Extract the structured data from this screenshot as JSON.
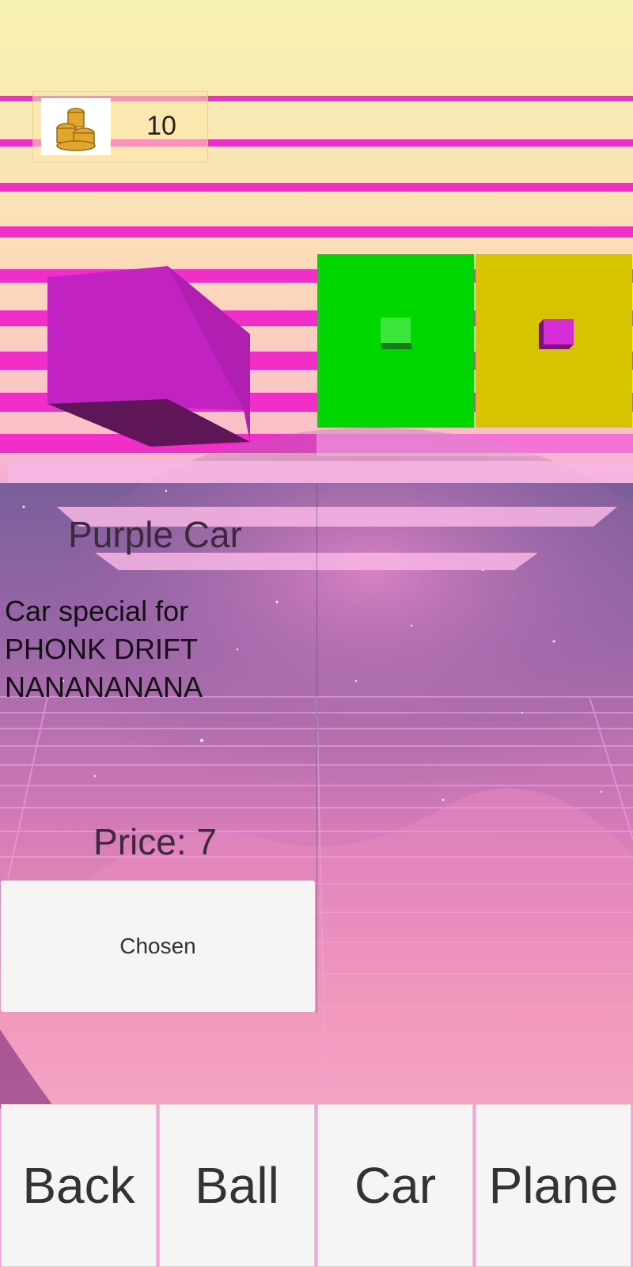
{
  "hud": {
    "coin_icon": "coin-stack-icon",
    "coins": "10"
  },
  "shop": {
    "items": [
      {
        "name": "green-car",
        "tile_color": "#00d600",
        "preview_color": "#3be63b"
      },
      {
        "name": "purple-car",
        "tile_color": "#d6c400",
        "preview_color": "#d82cd8"
      }
    ],
    "selected": {
      "title": "Purple Car",
      "description_lines": [
        "Car special for",
        "PHONK DRIFT",
        "NANANANANA"
      ],
      "price": "Price: 7",
      "action_label": "Chosen",
      "cube_color": "#c322c3"
    }
  },
  "nav": {
    "back": "Back",
    "ball": "Ball",
    "car": "Car",
    "plane": "Plane"
  }
}
